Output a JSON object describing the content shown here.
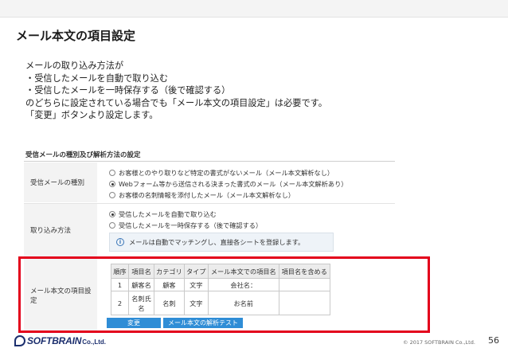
{
  "slide": {
    "title": "メール本文の項目設定",
    "intro_lines": [
      "メールの取り込み方法が",
      "・受信したメールを自動で取り込む",
      "・受信したメールを一時保存する（後で確認する）",
      "のどちらに設定されている場合でも「メール本文の項目設定」は必要です。",
      "「変更」ボタンより設定します。"
    ]
  },
  "settings": {
    "section_title": "受信メールの種別及び解析方法の設定",
    "mail_type": {
      "label": "受信メールの種別",
      "options": [
        {
          "text": "お客様とのやり取りなど特定の書式がないメール（メール本文解析なし）",
          "selected": false
        },
        {
          "text": "Webフォーム等から送信される決まった書式のメール（メール本文解析あり）",
          "selected": true
        },
        {
          "text": "お客様の名刺情報を添付したメール（メール本文解析なし）",
          "selected": false
        }
      ]
    },
    "import_method": {
      "label": "取り込み方法",
      "options": [
        {
          "text": "受信したメールを自動で取り込む",
          "selected": true
        },
        {
          "text": "受信したメールを一時保存する（後で確認する）",
          "selected": false
        }
      ],
      "info_text": "メールは自動でマッチングし、直接各シートを登録します。"
    },
    "body_fields": {
      "label": "メール本文の項目設定",
      "headers": [
        "順序",
        "項目名",
        "カテゴリ",
        "タイプ",
        "メール本文での項目名",
        "項目名を含める"
      ],
      "rows": [
        [
          "1",
          "顧客名",
          "顧客",
          "文字",
          "会社名：",
          ""
        ],
        [
          "2",
          "名刺氏名",
          "名刺",
          "文字",
          "お名前",
          ""
        ]
      ],
      "change_button": "変更",
      "test_button": "メール本文の解析テスト"
    }
  },
  "footer": {
    "logo_text": "SOFTBRAIN",
    "logo_sub": "Co.,Ltd.",
    "copyright": "© 2017 SOFTBRAIN Co.,Ltd.",
    "page_number": "56"
  },
  "colors": {
    "highlight": "#e3001b",
    "button": "#2f8dd6",
    "brand": "#1c2f6e"
  }
}
